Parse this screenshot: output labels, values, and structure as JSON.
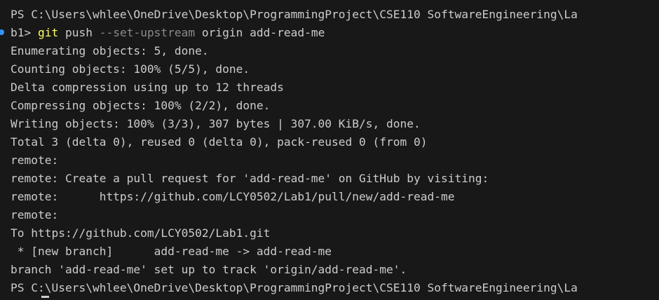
{
  "terminal": {
    "prompt_line_1": "PS C:\\Users\\whlee\\OneDrive\\Desktop\\ProgrammingProject\\CSE110 SoftwareEngineering\\La",
    "prompt_line_2_prefix": "b1> ",
    "command_git": "git",
    "command_push": " push ",
    "command_flag": "--set-upstream",
    "command_rest": " origin add-read-me",
    "output": [
      "Enumerating objects: 5, done.",
      "Counting objects: 100% (5/5), done.",
      "Delta compression using up to 12 threads",
      "Compressing objects: 100% (2/2), done.",
      "Writing objects: 100% (3/3), 307 bytes | 307.00 KiB/s, done.",
      "Total 3 (delta 0), reused 0 (delta 0), pack-reused 0 (from 0)",
      "remote:",
      "remote: Create a pull request for 'add-read-me' on GitHub by visiting:",
      "remote:      https://github.com/LCY0502/Lab1/pull/new/add-read-me",
      "remote:",
      "To https://github.com/LCY0502/Lab1.git",
      " * [new branch]      add-read-me -> add-read-me",
      "branch 'add-read-me' set up to track 'origin/add-read-me'."
    ],
    "final_prompt": "PS C:\\Users\\whlee\\OneDrive\\Desktop\\ProgrammingProject\\CSE110 SoftwareEngineering\\La",
    "colors": {
      "background": "#181818",
      "text": "#cccccc",
      "git_keyword": "#ffff64",
      "flag": "#8a8a8a",
      "command_marker": "#3794ff"
    }
  }
}
